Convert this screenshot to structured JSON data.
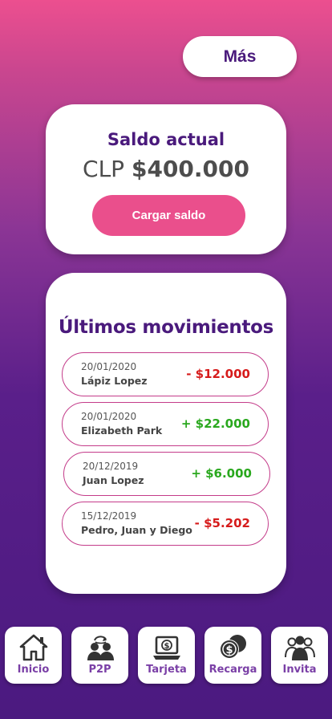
{
  "header": {
    "more_label": "Más"
  },
  "balance": {
    "title": "Saldo actual",
    "currency": "CLP",
    "amount": "$400.000",
    "load_label": "Cargar saldo"
  },
  "movements": {
    "title": "Últimos movimientos",
    "items": [
      {
        "date": "20/01/2020",
        "name": "Lápiz Lopez",
        "amount": "- $12.000",
        "sign": "negative"
      },
      {
        "date": "20/01/2020",
        "name": "Elizabeth Park",
        "amount": "+ $22.000",
        "sign": "positive"
      },
      {
        "date": "20/12/2019",
        "name": "Juan Lopez",
        "amount": "+ $6.000",
        "sign": "positive"
      },
      {
        "date": "15/12/2019",
        "name": "Pedro, Juan y Diego",
        "amount": "- $5.202",
        "sign": "negative"
      }
    ]
  },
  "nav": {
    "items": [
      {
        "label": "Inicio",
        "icon": "home-icon"
      },
      {
        "label": "P2P",
        "icon": "people-exchange-icon"
      },
      {
        "label": "Tarjeta",
        "icon": "laptop-dollar-icon"
      },
      {
        "label": "Recarga",
        "icon": "coins-icon"
      },
      {
        "label": "Invita",
        "icon": "group-icon"
      }
    ]
  },
  "colors": {
    "brand_purple": "#4a1a7c",
    "accent_pink": "#ea4f8c",
    "negative": "#d61b1b",
    "positive": "#2aa81e"
  }
}
